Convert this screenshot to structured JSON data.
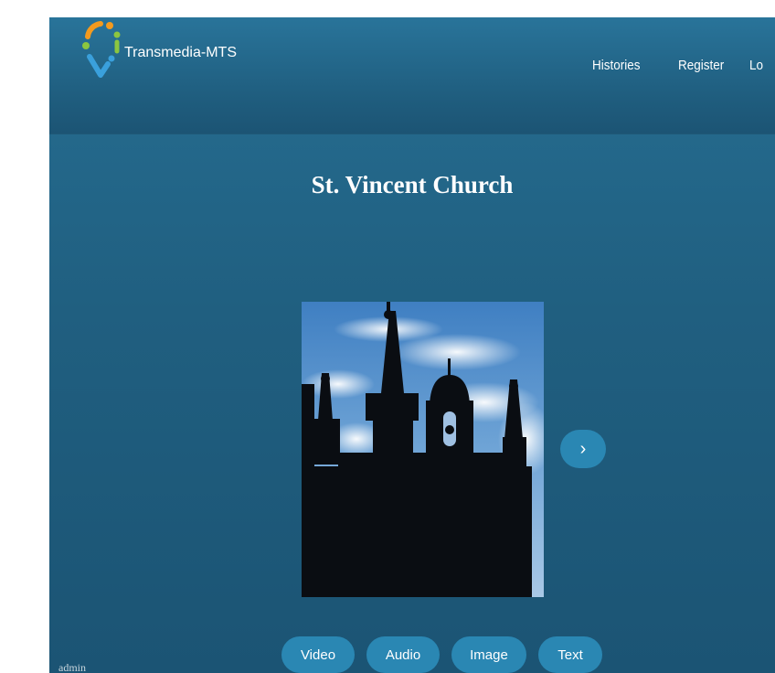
{
  "brand": {
    "name": "Transmedia-MTS",
    "logo_icon": "map-pin-logo-icon"
  },
  "nav": {
    "links": [
      {
        "label": "Histories"
      },
      {
        "label": "Register"
      },
      {
        "label": "Lo"
      }
    ]
  },
  "page": {
    "title": "St. Vincent Church"
  },
  "carousel": {
    "next_label": "›",
    "image_subject": "church-silhouette"
  },
  "media_buttons": [
    {
      "label": "Video"
    },
    {
      "label": "Audio"
    },
    {
      "label": "Image"
    },
    {
      "label": "Text"
    }
  ],
  "footer": {
    "user": "admin"
  },
  "colors": {
    "accent": "#2a87b3",
    "background": "#205f80",
    "logo_orange": "#f39a1e",
    "logo_green": "#8cc63f",
    "logo_blue": "#3aa0dc"
  }
}
